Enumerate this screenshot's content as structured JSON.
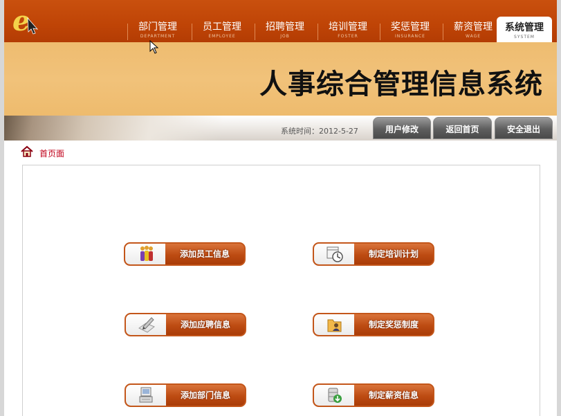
{
  "nav": {
    "items": [
      {
        "label": "部门管理",
        "sub": "DEPARTMENT"
      },
      {
        "label": "员工管理",
        "sub": "EMPLOYEE"
      },
      {
        "label": "招聘管理",
        "sub": "JOB"
      },
      {
        "label": "培训管理",
        "sub": "FOSTER"
      },
      {
        "label": "奖惩管理",
        "sub": "INSURANCE"
      },
      {
        "label": "薪资管理",
        "sub": "WAGE"
      },
      {
        "label": "系统管理",
        "sub": "SYSTEM"
      }
    ]
  },
  "banner": {
    "title": "人事综合管理信息系统"
  },
  "statusbar": {
    "time_label": "系统时间：2012-5-27",
    "buttons": [
      "用户修改",
      "返回首页",
      "安全退出"
    ]
  },
  "crumb": {
    "label": "首页面"
  },
  "actions": [
    {
      "label": "添加员工信息",
      "icon": "people-icon"
    },
    {
      "label": "制定培训计划",
      "icon": "calendar-clock-icon"
    },
    {
      "label": "添加应聘信息",
      "icon": "pen-paper-icon"
    },
    {
      "label": "制定奖惩制度",
      "icon": "folder-user-icon"
    },
    {
      "label": "添加部门信息",
      "icon": "computer-icon"
    },
    {
      "label": "制定薪资信息",
      "icon": "database-download-icon"
    }
  ],
  "colors": {
    "accent": "#c04808",
    "banner": "#f0c078",
    "crumb_text": "#c0001a"
  }
}
